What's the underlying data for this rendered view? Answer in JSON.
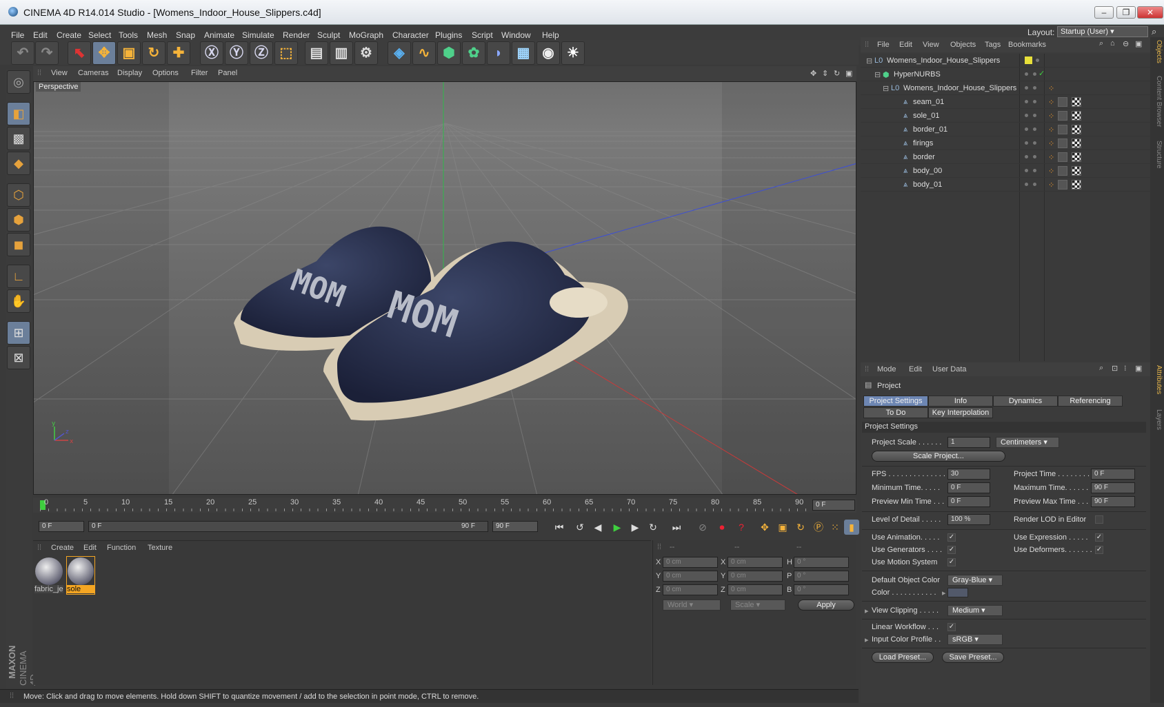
{
  "window": {
    "title": "CINEMA 4D R14.014 Studio - [Womens_Indoor_House_Slippers.c4d]"
  },
  "menu": [
    "File",
    "Edit",
    "Create",
    "Select",
    "Tools",
    "Mesh",
    "Snap",
    "Animate",
    "Simulate",
    "Render",
    "Sculpt",
    "MoGraph",
    "Character",
    "Plugins",
    "Script",
    "Window",
    "Help"
  ],
  "layout": {
    "label": "Layout:",
    "value": "Startup (User)"
  },
  "viewport": {
    "menu": [
      "View",
      "Cameras",
      "Display",
      "Options",
      "Filter",
      "Panel"
    ],
    "name": "Perspective",
    "label_text": "MOM",
    "axis_x": "x",
    "axis_y": "y",
    "axis_z": "z"
  },
  "timeline": {
    "ticks": [
      "0",
      "5",
      "10",
      "15",
      "20",
      "25",
      "30",
      "35",
      "40",
      "45",
      "50",
      "55",
      "60",
      "65",
      "70",
      "75",
      "80",
      "85",
      "90"
    ],
    "current": "0 F"
  },
  "transport": {
    "start": "0 F",
    "range_start": "0 F",
    "range_end": "90 F",
    "end": "90 F"
  },
  "materials": {
    "menu": [
      "Create",
      "Edit",
      "Function",
      "Texture"
    ],
    "items": [
      {
        "name": "fabric_je"
      },
      {
        "name": "sole"
      }
    ]
  },
  "coords": {
    "headers": [
      "--",
      "--",
      "--"
    ],
    "rows": [
      [
        "X",
        "0 cm",
        "X",
        "0 cm",
        "H",
        "0 °"
      ],
      [
        "Y",
        "0 cm",
        "Y",
        "0 cm",
        "P",
        "0 °"
      ],
      [
        "Z",
        "0 cm",
        "Z",
        "0 cm",
        "B",
        "0 °"
      ]
    ],
    "world": "World",
    "scale": "Scale",
    "apply": "Apply"
  },
  "objects": {
    "menu": [
      "File",
      "Edit",
      "View",
      "Objects",
      "Tags",
      "Bookmarks"
    ],
    "tree": [
      {
        "name": "Womens_Indoor_House_Slippers"
      },
      {
        "name": "HyperNURBS"
      },
      {
        "name": "Womens_Indoor_House_Slippers"
      },
      {
        "name": "seam_01"
      },
      {
        "name": "sole_01"
      },
      {
        "name": "border_01"
      },
      {
        "name": "firings"
      },
      {
        "name": "border"
      },
      {
        "name": "body_00"
      },
      {
        "name": "body_01"
      }
    ]
  },
  "attributes": {
    "menu": [
      "Mode",
      "Edit",
      "User Data"
    ],
    "title": "Project",
    "tabs": [
      "Project Settings",
      "Info",
      "Dynamics",
      "Referencing",
      "To Do",
      "Key Interpolation"
    ],
    "section": "Project Settings",
    "project_scale": {
      "label": "Project Scale . . . . . .",
      "value": "1",
      "unit": "Centimeters"
    },
    "scale_project": "Scale Project...",
    "fps": {
      "label": "FPS . . . . . . . . . . . . . .",
      "value": "30"
    },
    "project_time": {
      "label": "Project Time . . . . . . . .",
      "value": "0 F"
    },
    "min_time": {
      "label": "Minimum Time. . . . .",
      "value": "0 F"
    },
    "max_time": {
      "label": "Maximum Time. . . . . . .",
      "value": "90 F"
    },
    "prev_min": {
      "label": "Preview Min Time . . .",
      "value": "0 F"
    },
    "prev_max": {
      "label": "Preview Max Time . . .",
      "value": "90 F"
    },
    "lod": {
      "label": "Level of Detail . . . . .",
      "value": "100 %"
    },
    "render_lod": "Render LOD in Editor",
    "use_anim": "Use Animation. . . . .",
    "use_expr": "Use Expression . . . . .",
    "use_gen": "Use Generators . . . .",
    "use_def": "Use Deformers. . . . . . .",
    "use_motion": "Use Motion System",
    "def_color": {
      "label": "Default Object Color",
      "value": "Gray-Blue"
    },
    "color": {
      "label": "Color . . . . . . . . . . ."
    },
    "view_clip": {
      "label": "View Clipping . . . . .",
      "value": "Medium"
    },
    "linear": "Linear Workflow . . .",
    "input_profile": {
      "label": "Input Color Profile . .",
      "value": "sRGB"
    },
    "load_preset": "Load Preset...",
    "save_preset": "Save Preset..."
  },
  "side_tabs": [
    "Objects",
    "Content Browser",
    "Structure",
    "Attributes",
    "Layers"
  ],
  "brand": {
    "maxon": "MAXON",
    "c4d": "CINEMA 4D"
  },
  "status": "Move: Click and drag to move elements. Hold down SHIFT to quantize movement / add to the selection in point mode, CTRL to remove."
}
